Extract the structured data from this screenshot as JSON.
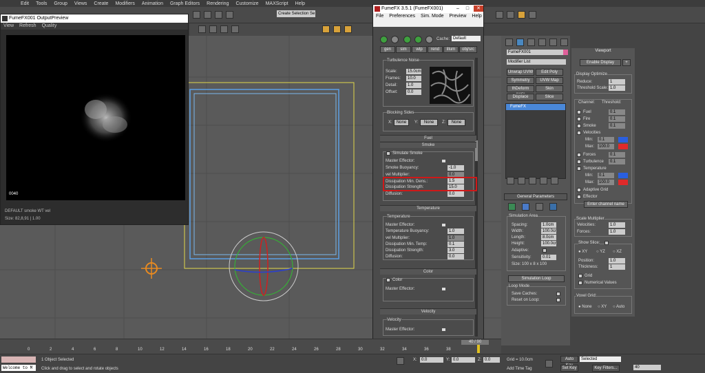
{
  "menubar": {
    "items": [
      "Edit",
      "Tools",
      "Group",
      "Views",
      "Create",
      "Modifiers",
      "Animation",
      "Graph Editors",
      "Rendering",
      "Customize",
      "MAXScript",
      "Help"
    ]
  },
  "toolbar": {
    "selection_set": "Create Selection Se"
  },
  "preview": {
    "title": "FumeFX001 OutputPreview",
    "menu": [
      "View",
      "Refresh",
      "Quality"
    ],
    "frame": "0040",
    "info1": "DEFAULT smoke WT vel",
    "info2": "Size: 82,8,91 | 1.00"
  },
  "fume": {
    "title": "FumeFX 3.5.1 (FumeFX001)",
    "menu": [
      "File",
      "Preferences",
      "Sim. Mode",
      "Preview",
      "Help"
    ],
    "cache_label": "Cache:",
    "cache_value": "Default",
    "tabs": [
      "gen",
      "sim",
      "wtp",
      "rend",
      "illum",
      "obj/src"
    ],
    "turb": {
      "title": "Turbulence Noise",
      "scale_label": "Scale:",
      "scale": "15.0cm",
      "frames_label": "Frames:",
      "frames": "10.0",
      "detail_label": "Detail:",
      "detail": "1.0",
      "offset_label": "Offset:",
      "offset": "0.0"
    },
    "blocking": {
      "title": "Blocking Sides",
      "x": "X:",
      "y": "Y:",
      "z": "Z:",
      "none": "None"
    },
    "fuel": "Fuel",
    "smoke": "Smoke",
    "smoke_rows": {
      "simulate": "Simulate Smoke",
      "master": "Master Effector:",
      "buoy": "Smoke Buoyancy:",
      "buoy_v": "-1.0",
      "vel": "vel Multiplier:",
      "vel_v": "0.0",
      "dens": "Dissipation Min. Dens.:",
      "dens_v": "1.5",
      "str": "Dissipation Strength:",
      "str_v": "15.0",
      "diff": "Diffusion:",
      "diff_v": "0.0"
    },
    "temperature": "Temperature",
    "temp_rows": {
      "group": "Temperature",
      "master": "Master Effector:",
      "buoy": "Temperature Buoyancy:",
      "buoy_v": "1.0",
      "vel": "vel Multiplier:",
      "vel_v": "1.0",
      "min": "Dissipation Min. Temp:",
      "min_v": "0.1",
      "str": "Dissipation Strength:",
      "str_v": "3.0",
      "diff": "Diffusion:",
      "diff_v": "0.0"
    },
    "color": "Color",
    "color_rows": {
      "color": "Color",
      "master": "Master Effector:"
    },
    "velocity": "Velocity",
    "vel_rows": {
      "group": "Velocity",
      "master": "Master Effector:"
    }
  },
  "modify": {
    "name": "FumeFX001",
    "modlist": "Modifier List",
    "buttons": [
      "Unwrap UVW",
      "Edit Poly",
      "Symmetry",
      "UVW Map",
      "thDeform (WS)",
      "Skin",
      "Displace",
      "Slice"
    ],
    "stack_item": "FumeFX",
    "gp_title": "General Parameters",
    "sim_area": "Simulation Area",
    "spacing": "Spacing:",
    "spacing_v": "1.0cm",
    "width": "Width:",
    "width_v": "100.0cr",
    "length": "Length:",
    "length_v": "8.0cm",
    "height": "Height:",
    "height_v": "100.0cr",
    "adaptive": "Adaptive:",
    "sens": "Sensitivity:",
    "sens_v": "0.01",
    "size": "Size:  100 x 8 x 100",
    "sim_loop": "Simulation Loop",
    "loop_mode": "Loop Mode",
    "save_caches": "Save Caches:",
    "reset_loop": "Reset on Loop:"
  },
  "viewportpanel": {
    "title": "Viewport",
    "enable": "Enable Display",
    "opt": "Display Optimize",
    "reduce": "Reduce:",
    "reduce_v": "1",
    "thscale": "Threshold Scale:",
    "thscale_v": "1.0",
    "channel": "Channel:",
    "threshold": "Threshold:",
    "fuel": "Fuel",
    "fire": "Fire",
    "smoke": "Smoke",
    "velocities": "Velocities",
    "min": "Min:",
    "max": "Max:",
    "forces": "Forces",
    "turbulence": "Turbulence",
    "temperature": "Temperature",
    "tmin": "Min:",
    "tmax": "Max:",
    "adaptive": "Adaptive Grid",
    "effector": "Effector",
    "enter_ch": "Enter channel name",
    "scale_mult": "Scale Multiplier",
    "sm_vel": "Velocities:",
    "sm_vel_v": "1.0",
    "sm_forces": "Forces:",
    "sm_forces_v": "1.0",
    "show_slice": "Show Slice:",
    "xy": "XY",
    "yz": "YZ",
    "xz": "XZ",
    "position": "Position:",
    "pos_v": "1.0",
    "thickness": "Thickness:",
    "thick_v": "1",
    "grid": "Grid",
    "numerical": "Numerical Values",
    "voxel": "Voxel Grid:",
    "none": "None",
    "vxy": "XY",
    "auto": "Auto",
    "ch_values": [
      "0.1",
      "0.1",
      "0.1",
      "0.1",
      "100.0",
      "0.1",
      "0.1",
      "0.1",
      "100.0"
    ],
    "blue": "#2a5fe0",
    "red": "#e02a2a"
  },
  "timeline": {
    "counter": "40 / 90",
    "ticks": [
      "0",
      "2",
      "4",
      "6",
      "8",
      "10",
      "12",
      "14",
      "16",
      "18",
      "20",
      "22",
      "24",
      "26",
      "28",
      "30",
      "32",
      "34",
      "36",
      "38"
    ]
  },
  "status": {
    "welcome": "Welcome to M",
    "objects": "1 Object Selected",
    "prompt": "Click and drag to select and rotate objects",
    "x": "X:",
    "x_v": "0.0",
    "y": "Y:",
    "y_v": "0.0",
    "z": "Z:",
    "z_v": "0.0",
    "grid": "Grid = 10.0cm",
    "autokey": "Auto Key",
    "selected": "Selected",
    "setkey": "Set Key",
    "keyfilters": "Key Filters...",
    "tag": "Add Time Tag",
    "frame": "40"
  }
}
